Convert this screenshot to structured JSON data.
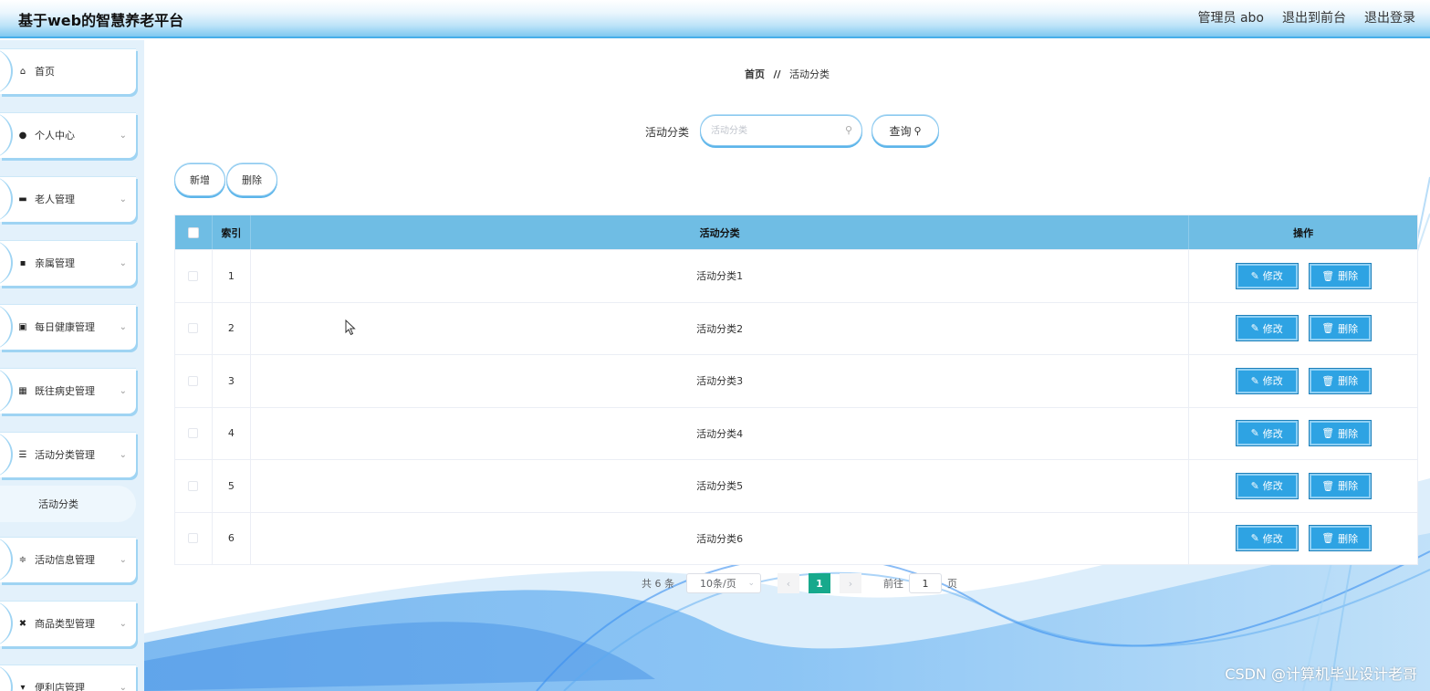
{
  "header": {
    "title": "基于web的智慧养老平台",
    "user_label": "管理员 abo",
    "front_link": "退出到前台",
    "logout_link": "退出登录"
  },
  "sidebar": {
    "items": [
      {
        "label": "首页",
        "icon": "home-icon",
        "glyph": "⌂"
      },
      {
        "label": "个人中心",
        "icon": "user-icon",
        "glyph": "●"
      },
      {
        "label": "老人管理",
        "icon": "briefcase-icon",
        "glyph": "▬"
      },
      {
        "label": "亲属管理",
        "icon": "card-icon",
        "glyph": "▪"
      },
      {
        "label": "每日健康管理",
        "icon": "clipboard-icon",
        "glyph": "▣"
      },
      {
        "label": "既往病史管理",
        "icon": "grid-icon",
        "glyph": "▦"
      },
      {
        "label": "活动分类管理",
        "icon": "list-icon",
        "glyph": "☰"
      },
      {
        "label": "活动信息管理",
        "icon": "sliders-icon",
        "glyph": "≑"
      },
      {
        "label": "商品类型管理",
        "icon": "tag-icon",
        "glyph": "✖"
      },
      {
        "label": "便利店管理",
        "icon": "store-icon",
        "glyph": "▾"
      }
    ],
    "submenu": {
      "label": "活动分类"
    }
  },
  "breadcrumb": {
    "home": "首页",
    "separator": "//",
    "current": "活动分类"
  },
  "search": {
    "label": "活动分类",
    "placeholder": "活动分类",
    "button_label": "查询"
  },
  "toolbar": {
    "add_label": "新增",
    "delete_label": "删除"
  },
  "table": {
    "headers": {
      "index": "索引",
      "name": "活动分类",
      "ops": "操作"
    },
    "rows": [
      {
        "index": "1",
        "name": "活动分类1"
      },
      {
        "index": "2",
        "name": "活动分类2"
      },
      {
        "index": "3",
        "name": "活动分类3"
      },
      {
        "index": "4",
        "name": "活动分类4"
      },
      {
        "index": "5",
        "name": "活动分类5"
      },
      {
        "index": "6",
        "name": "活动分类6"
      }
    ],
    "edit_label": "修改",
    "delete_label": "删除"
  },
  "pagination": {
    "total": "共 6 条",
    "page_size": "10条/页",
    "current_page": "1",
    "goto_prefix": "前往",
    "goto_value": "1",
    "goto_suffix": "页"
  },
  "watermark": "CSDN @计算机毕业设计老哥",
  "colors": {
    "header_accent": "#47aee9",
    "table_header": "#6fbde4",
    "op_button": "#2ea3e3",
    "active_page": "#17a98c"
  }
}
